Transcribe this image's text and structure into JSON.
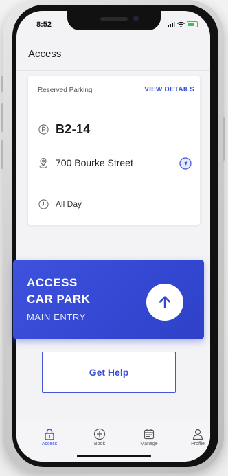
{
  "status_bar": {
    "time": "8:52"
  },
  "header": {
    "title": "Access"
  },
  "reservation": {
    "type_label": "Reserved Parking",
    "details_link": "VIEW DETAILS",
    "bay": "B2-14",
    "address": "700 Bourke Street",
    "duration": "All Day"
  },
  "access_panel": {
    "line1": "ACCESS",
    "line2": "CAR PARK",
    "line3": "MAIN ENTRY"
  },
  "help_button": {
    "label": "Get Help"
  },
  "tabs": [
    {
      "label": "Access",
      "icon": "lock-icon",
      "active": true
    },
    {
      "label": "Book",
      "icon": "plus-circle-icon",
      "active": false
    },
    {
      "label": "Manage",
      "icon": "calendar-icon",
      "active": false
    },
    {
      "label": "Profile",
      "icon": "person-icon",
      "active": false
    }
  ],
  "colors": {
    "accent": "#3b4fd8",
    "panel": "#3347d2",
    "background": "#f3f3f5"
  }
}
